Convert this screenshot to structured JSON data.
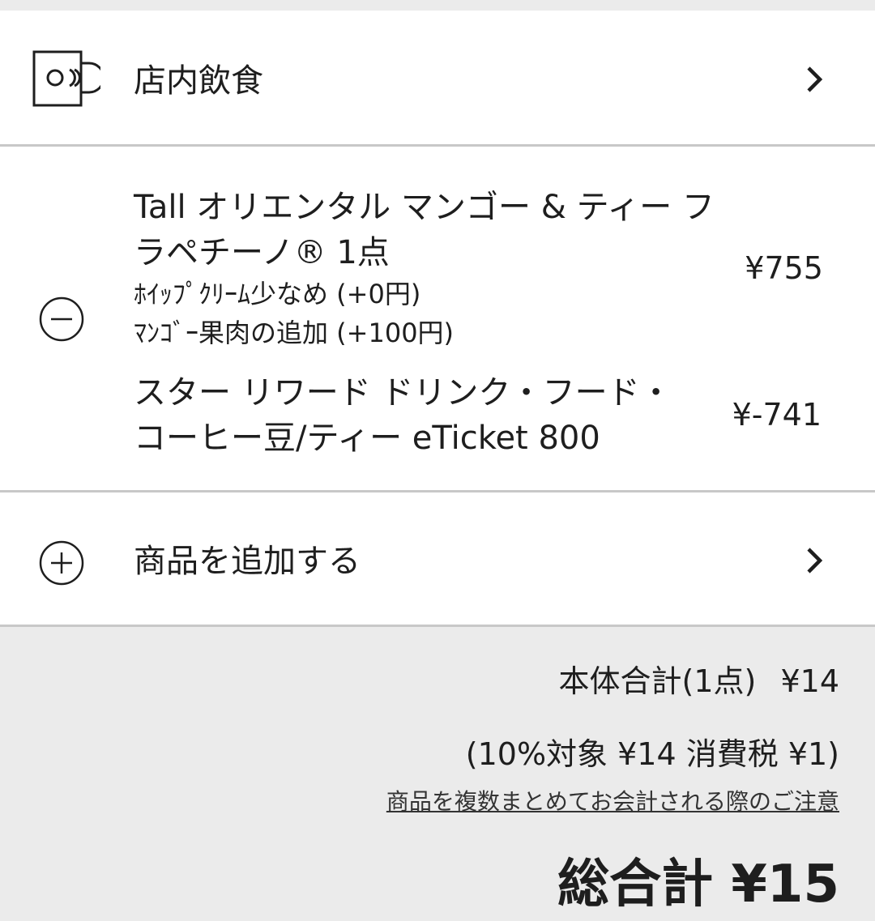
{
  "dine_in": {
    "label": "店内飲食"
  },
  "order": {
    "item": {
      "name": "Tall オリエンタル マンゴー & ティー フラペチーノ® 1点",
      "options": [
        "ﾎｲｯﾌﾟｸﾘｰﾑ少なめ (+0円)",
        "ﾏﾝｺﾞｰ果肉の追加 (+100円)"
      ],
      "price": "¥755"
    },
    "ticket": {
      "name": "スター リワード ドリンク・フード・コーヒー豆/ティー eTicket 800",
      "price": "¥-741"
    }
  },
  "add_item": {
    "label": "商品を追加する"
  },
  "summary": {
    "subtotal_label": "本体合計(1点)",
    "subtotal_value": "¥14",
    "tax_line": "(10%対象 ¥14 消費税 ¥1)",
    "notice_link": "商品を複数まとめてお会計される際のご注意",
    "grand_total": "総合計 ¥15"
  },
  "icons": {
    "dine": "cup-icon",
    "remove": "minus-circle-icon",
    "add": "plus-circle-icon",
    "next": "chevron-right-icon"
  }
}
